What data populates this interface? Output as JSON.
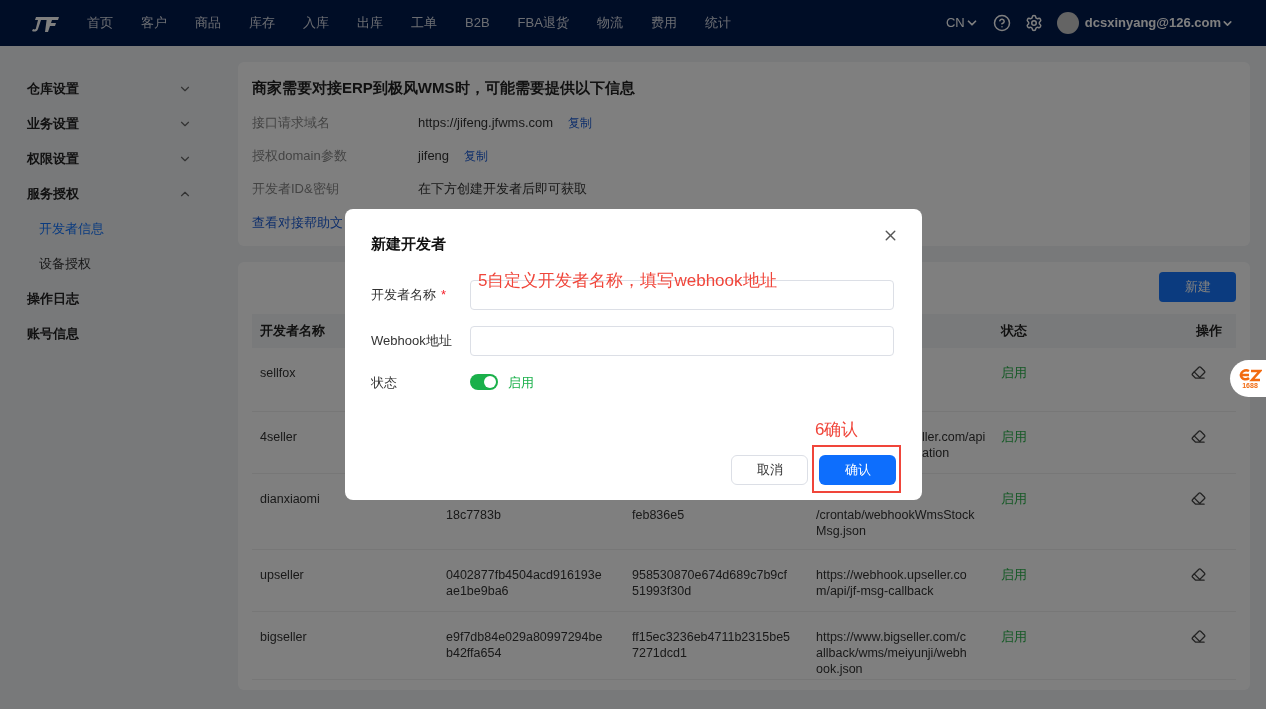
{
  "nav": {
    "items": [
      "首页",
      "客户",
      "商品",
      "库存",
      "入库",
      "出库",
      "工单",
      "B2B",
      "FBA退货",
      "物流",
      "费用",
      "统计"
    ],
    "language": "CN",
    "user": "dcsxinyang@126.com"
  },
  "sidebar": [
    {
      "label": "仓库设置",
      "expanded": false
    },
    {
      "label": "业务设置",
      "expanded": false
    },
    {
      "label": "权限设置",
      "expanded": false
    },
    {
      "label": "服务授权",
      "expanded": true,
      "children": [
        {
          "label": "开发者信息",
          "selected": true
        },
        {
          "label": "设备授权",
          "selected": false
        }
      ]
    },
    {
      "label": "操作日志"
    },
    {
      "label": "账号信息"
    }
  ],
  "info_card": {
    "title": "商家需要对接ERP到极风WMS时，可能需要提供以下信息",
    "rows": [
      {
        "label": "接口请求域名",
        "value": "https://jifeng.jfwms.com",
        "action": "复制"
      },
      {
        "label": "授权domain参数",
        "value": "jifeng",
        "action": "复制"
      },
      {
        "label": "开发者ID&密钥",
        "value": "在下方创建开发者后即可获取"
      }
    ],
    "help_link": "查看对接帮助文"
  },
  "developers": {
    "new_button": "新建",
    "header": {
      "name": "开发者名称",
      "status": "状态",
      "actions": "操作"
    },
    "rows": [
      {
        "name": "sellfox",
        "status": "启用"
      },
      {
        "name": "4seller",
        "webhook": {
          "lines": [
            "ller.com/api",
            "ation"
          ]
        },
        "status": "启用"
      },
      {
        "name": "dianxiaomi",
        "developer_id": {
          "lines": [
            "18c7783b"
          ]
        },
        "secret": {
          "lines": [
            "feb836e5"
          ]
        },
        "webhook": {
          "lines": [
            "/crontab/webhookWmsStock",
            "Msg.json"
          ]
        },
        "status": "启用"
      },
      {
        "name": "upseller",
        "developer_id": {
          "lines": [
            "0402877fb4504acd916193e",
            "ae1be9ba6"
          ]
        },
        "secret": {
          "lines": [
            "958530870e674d689c7b9cf",
            "51993f30d"
          ]
        },
        "webhook": {
          "lines": [
            "https://webhook.upseller.co",
            "m/api/jf-msg-callback"
          ]
        },
        "status": "启用"
      },
      {
        "name": "bigseller",
        "developer_id": {
          "lines": [
            "e9f7db84e029a80997294be",
            "b42ffa654"
          ]
        },
        "secret": {
          "lines": [
            "ff15ec3236eb4711b2315be5",
            "7271dcd1"
          ]
        },
        "webhook": {
          "lines": [
            "https://www.bigseller.com/c",
            "allback/wms/meiyunji/webh",
            "ook.json"
          ]
        },
        "status": "启用"
      }
    ]
  },
  "modal": {
    "title": "新建开发者",
    "fields": [
      {
        "label": "开发者名称",
        "required_mark": "*"
      },
      {
        "label": "Webhook地址"
      }
    ],
    "status": {
      "label": "状态",
      "on": true,
      "text": "启用"
    },
    "cancel": "取消",
    "confirm": "确认"
  },
  "annotations": [
    {
      "kind": "note",
      "text": "5自定义开发者名称，填写webhook地址"
    },
    {
      "kind": "highlight",
      "text": "6确认"
    }
  ],
  "float_badge": "1688"
}
